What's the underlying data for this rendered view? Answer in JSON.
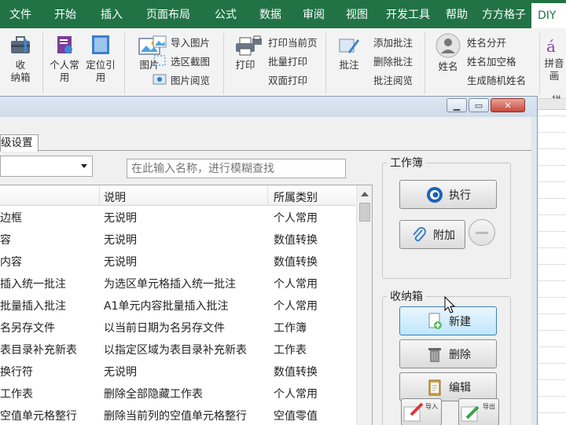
{
  "ribbon_tabs": [
    "文件",
    "开始",
    "插入",
    "页面布局",
    "公式",
    "数据",
    "审阅",
    "视图",
    "开发工具",
    "帮助",
    "方方格子",
    "DIY"
  ],
  "ribbon": {
    "shoujia": "收\n纳箱",
    "personal": "个人常\n用",
    "locate": "定位引\n用",
    "picture": "图片",
    "import_pic": "导入图片",
    "select_shot": "选区截图",
    "pic_view": "图片阅览",
    "print": "打印",
    "print_page": "打印当前页",
    "batch_print": "批量打印",
    "duplex_print": "双面打印",
    "comment": "批注",
    "add_comment": "添加批注",
    "del_comment": "删除批注",
    "view_comment": "批注阅览",
    "name": "姓名",
    "name_split": "姓名分开",
    "name_space": "姓名加空格",
    "random_name": "生成随机姓名",
    "pinyin": "拼音\n画",
    "pinyin_group": "拼"
  },
  "dialog": {
    "tab_label": "级设置",
    "search_placeholder": "在此输入名称，进行模糊查找",
    "list_headers": [
      "说明",
      "所属类别"
    ],
    "rows": [
      {
        "name": "边框",
        "desc": "无说明",
        "cat": "个人常用"
      },
      {
        "name": "容",
        "desc": "无说明",
        "cat": "数值转换"
      },
      {
        "name": "内容",
        "desc": "无说明",
        "cat": "数值转换"
      },
      {
        "name": "插入统一批注",
        "desc": "为选区单元格插入统一批注",
        "cat": "个人常用"
      },
      {
        "name": "批量插入批注",
        "desc": "A1单元内容批量插入批注",
        "cat": "个人常用"
      },
      {
        "name": "名另存文件",
        "desc": "以当前日期为名另存文件",
        "cat": "工作簿"
      },
      {
        "name": "表目录补充新表",
        "desc": "以指定区域为表目录补充新表",
        "cat": "工作表"
      },
      {
        "name": "换行符",
        "desc": "无说明",
        "cat": "数值转换"
      },
      {
        "name": "工作表",
        "desc": "删除全部隐藏工作表",
        "cat": "个人常用"
      },
      {
        "name": "空值单元格整行",
        "desc": "删除当前列的空值单元格整行",
        "cat": "空值零值"
      }
    ],
    "workbook_group": "工作簿",
    "execute": "执行",
    "attach": "附加",
    "box_group": "收纳箱",
    "new": "新建",
    "delete": "删除",
    "edit": "编辑",
    "import": "导入",
    "export": "导出"
  }
}
